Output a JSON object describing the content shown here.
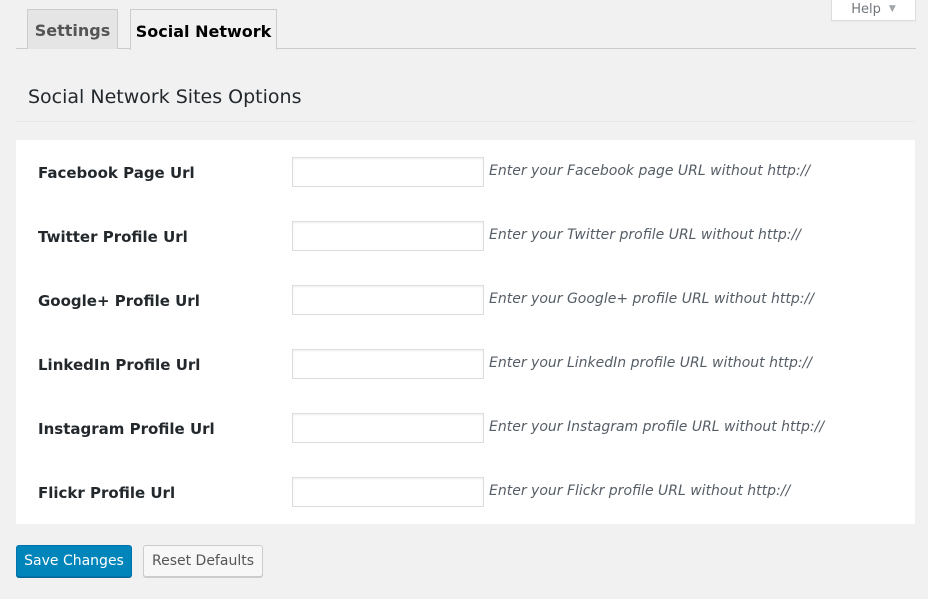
{
  "help": {
    "label": "Help"
  },
  "tabs": [
    {
      "label": "Settings",
      "active": false
    },
    {
      "label": "Social Network",
      "active": true
    }
  ],
  "section": {
    "title": "Social Network Sites Options"
  },
  "fields": [
    {
      "label": "Facebook Page Url",
      "value": "",
      "hint": "Enter your Facebook page URL without http://"
    },
    {
      "label": "Twitter Profile Url",
      "value": "",
      "hint": "Enter your Twitter profile URL without http://"
    },
    {
      "label": "Google+ Profile Url",
      "value": "",
      "hint": "Enter your Google+ profile URL without http://"
    },
    {
      "label": "LinkedIn Profile Url",
      "value": "",
      "hint": "Enter your LinkedIn profile URL without http://"
    },
    {
      "label": "Instagram Profile Url",
      "value": "",
      "hint": "Enter your Instagram profile URL without http://"
    },
    {
      "label": "Flickr Profile Url",
      "value": "",
      "hint": "Enter your Flickr profile URL without http://"
    }
  ],
  "buttons": {
    "save": "Save Changes",
    "reset": "Reset Defaults"
  },
  "colors": {
    "primary": "#0085ba",
    "background": "#f1f1f1"
  }
}
